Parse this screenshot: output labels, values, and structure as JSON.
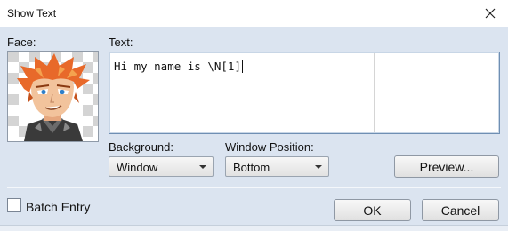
{
  "window": {
    "title": "Show Text"
  },
  "face": {
    "label": "Face:",
    "image_description": "portrait-avatar-icon"
  },
  "text": {
    "label": "Text:",
    "value": "Hi my name is \\N[1]"
  },
  "background": {
    "label": "Background:",
    "selected": "Window"
  },
  "window_position": {
    "label": "Window Position:",
    "selected": "Bottom"
  },
  "buttons": {
    "preview": "Preview...",
    "ok": "OK",
    "cancel": "Cancel"
  },
  "batch_entry": {
    "label": "Batch Entry",
    "checked": false
  },
  "colors": {
    "dialog_bg": "#dbe4f0",
    "input_border": "#6f8fb3",
    "hair": "#e8692a",
    "shirt": "#3a3a3a"
  }
}
